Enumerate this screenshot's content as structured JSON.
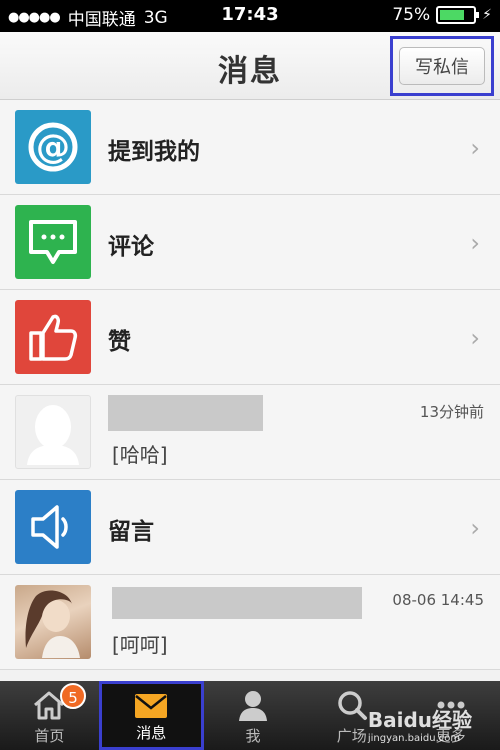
{
  "status_bar": {
    "carrier": "中国联通",
    "network": "3G",
    "time": "17:43",
    "battery": "75%",
    "battery_level": 0.75
  },
  "navbar": {
    "title": "消息",
    "compose_label": "写私信"
  },
  "rows": [
    {
      "label": "提到我的",
      "icon": "at-icon"
    },
    {
      "label": "评论",
      "icon": "comment-icon"
    },
    {
      "label": "赞",
      "icon": "thumbs-up-icon"
    },
    {
      "type": "message",
      "time": "13分钟前",
      "text": "[哈哈]",
      "avatar": "default-avatar"
    },
    {
      "label": "留言",
      "icon": "speaker-icon"
    },
    {
      "type": "message",
      "time": "08-06 14:45",
      "text": "[呵呵]",
      "avatar": "photo-avatar"
    }
  ],
  "tabs": [
    {
      "label": "首页",
      "icon": "home-icon",
      "badge": "5"
    },
    {
      "label": "消息",
      "icon": "mail-icon"
    },
    {
      "label": "我",
      "icon": "person-icon"
    },
    {
      "label": "广场",
      "icon": "search-icon"
    },
    {
      "label": "更多",
      "icon": "more-icon"
    }
  ],
  "watermark": {
    "brand": "Baidu经验",
    "url": "jingyan.baidu.com"
  },
  "colors": {
    "accent_highlight": "#3a3fcf",
    "badge": "#f06a24"
  }
}
